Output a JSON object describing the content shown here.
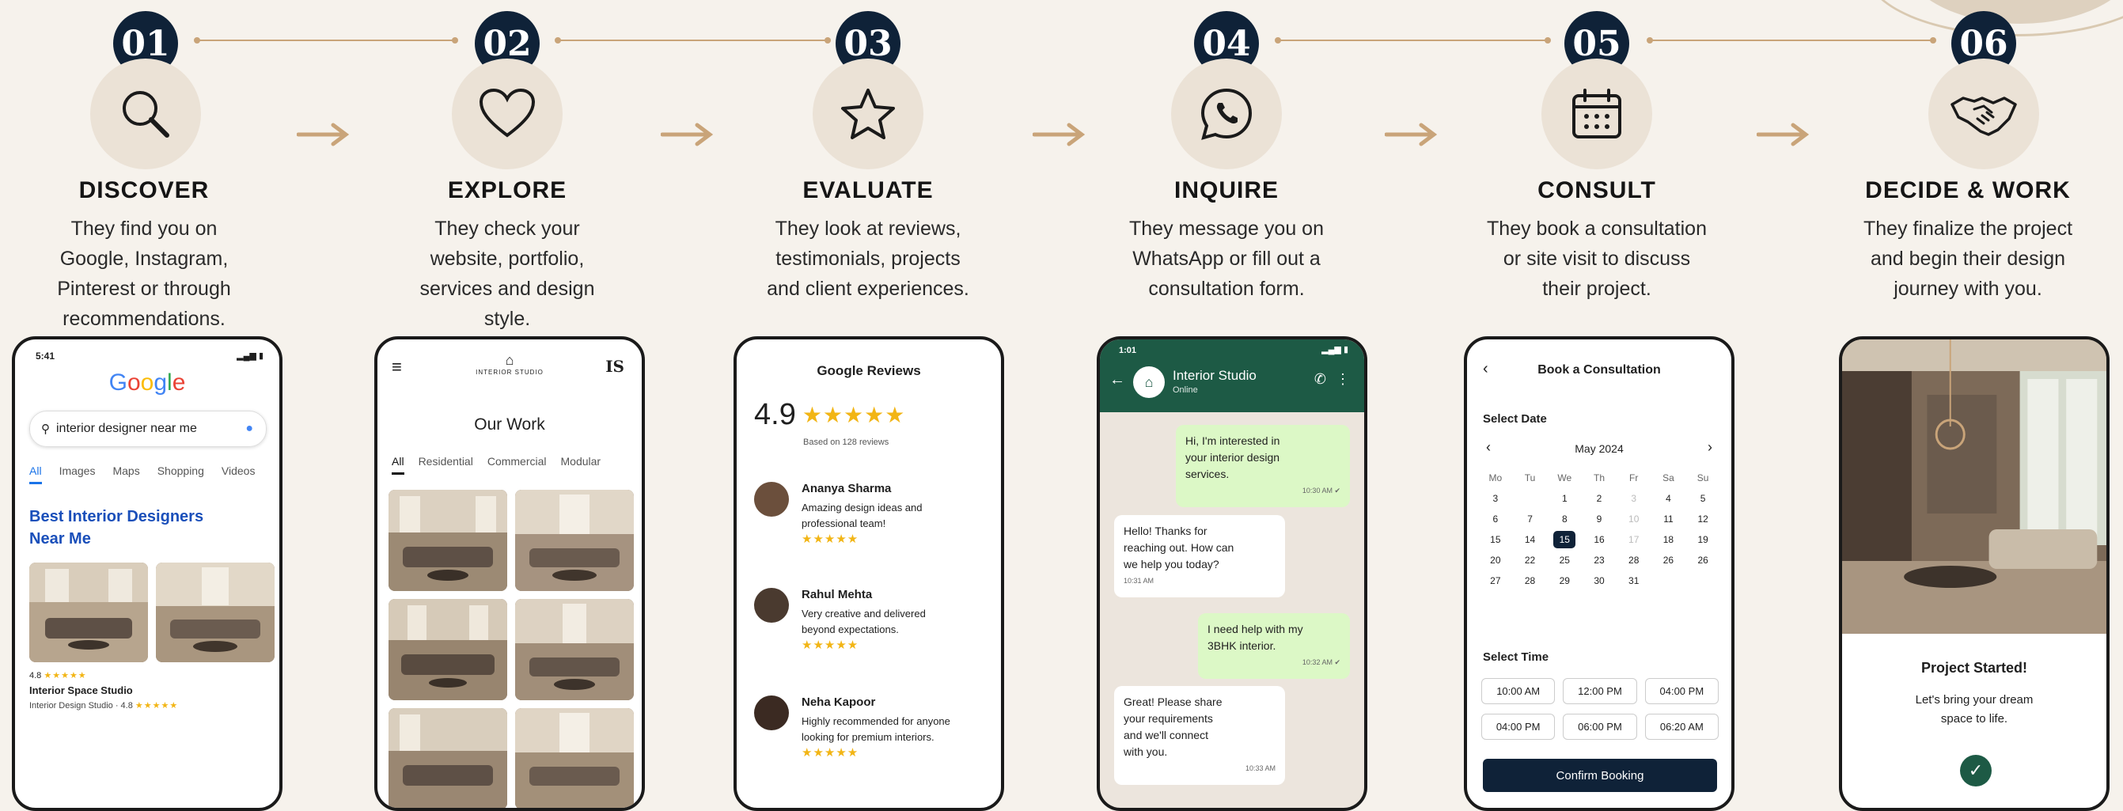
{
  "steps": [
    {
      "num": "01",
      "title": "DISCOVER",
      "desc": [
        "They find you on",
        "Google, Instagram,",
        "Pinterest or through",
        "recommendations."
      ],
      "icon": "magnifier-icon"
    },
    {
      "num": "02",
      "title": "EXPLORE",
      "desc": [
        "They check your",
        "website, portfolio,",
        "services and design",
        "style."
      ],
      "icon": "heart-icon"
    },
    {
      "num": "03",
      "title": "EVALUATE",
      "desc": [
        "They look at reviews,",
        "testimonials, projects",
        "and client experiences."
      ],
      "icon": "star-icon"
    },
    {
      "num": "04",
      "title": "INQUIRE",
      "desc": [
        "They message you on",
        "WhatsApp or fill out a",
        "consultation form."
      ],
      "icon": "whatsapp-icon"
    },
    {
      "num": "05",
      "title": "CONSULT",
      "desc": [
        "They book a consultation",
        "or site visit to discuss",
        "their project."
      ],
      "icon": "calendar-icon"
    },
    {
      "num": "06",
      "title": "DECIDE & WORK",
      "desc": [
        "They finalize the project",
        "and begin their design",
        "journey with you."
      ],
      "icon": "handshake-icon"
    }
  ],
  "google": {
    "time": "5:41",
    "logo": "Google",
    "query": "interior designer near me",
    "tabs": [
      "All",
      "Images",
      "Maps",
      "Shopping",
      "Videos"
    ],
    "heading1": "Best Interior Designers",
    "heading2": "Near Me",
    "rating": "4.8",
    "rating_stars": "★★★★★",
    "studio": "Interior Space Studio",
    "studio_sub": "Interior Design Studio · 4.8",
    "studio_sub_stars": "★★★★★"
  },
  "portfolio": {
    "brand": "INTERIOR STUDIO",
    "initials": "IS",
    "title": "Our Work",
    "tabs": [
      "All",
      "Residential",
      "Commercial",
      "Modular"
    ]
  },
  "reviews": {
    "title": "Google Reviews",
    "score": "4.9",
    "stars": "★★★★★",
    "based": "Based on 128 reviews",
    "items": [
      {
        "name": "Ananya Sharma",
        "text": [
          "Amazing design ideas and",
          "professional team!"
        ],
        "stars": "★★★★★"
      },
      {
        "name": "Rahul Mehta",
        "text": [
          "Very creative and delivered",
          "beyond expectations."
        ],
        "stars": "★★★★★"
      },
      {
        "name": "Neha Kapoor",
        "text": [
          "Highly recommended for anyone",
          "looking for premium interiors."
        ],
        "stars": "★★★★★"
      }
    ]
  },
  "chat": {
    "time": "1:01",
    "name": "Interior Studio",
    "status": "Online",
    "messages": [
      {
        "from": "me",
        "lines": [
          "Hi, I'm interested in",
          "your interior design",
          "services."
        ],
        "time": "10:30 AM ✔"
      },
      {
        "from": "them",
        "lines": [
          "Hello! Thanks for",
          "reaching out. How can",
          "we help you today?"
        ],
        "time": "10:31 AM"
      },
      {
        "from": "me",
        "lines": [
          "I need help with my",
          "3BHK interior."
        ],
        "time": "10:32 AM ✔"
      },
      {
        "from": "them",
        "lines": [
          "Great! Please share",
          "your requirements",
          "and we'll connect",
          "with you."
        ],
        "time": "10:33 AM"
      }
    ]
  },
  "booking": {
    "title": "Book a Consultation",
    "select_date": "Select Date",
    "month": "May 2024",
    "weekdays": [
      "Mo",
      "Tu",
      "We",
      "Th",
      "Fr",
      "Sa",
      "Su"
    ],
    "weeks": [
      [
        "3",
        "",
        "1",
        "2",
        "3",
        "4",
        "5"
      ],
      [
        "6",
        "7",
        "8",
        "9",
        "10",
        "11",
        "12"
      ],
      [
        "15",
        "14",
        "15",
        "16",
        "17",
        "18",
        "19"
      ],
      [
        "20",
        "22",
        "25",
        "23",
        "28",
        "26",
        "26"
      ],
      [
        "27",
        "28",
        "29",
        "30",
        "31",
        "",
        ""
      ]
    ],
    "selected_day": "15",
    "select_time": "Select Time",
    "times": [
      "10:00 AM",
      "12:00 PM",
      "04:00 PM",
      "04:00 PM",
      "06:00 PM",
      "06:20 AM"
    ],
    "confirm": "Confirm Booking"
  },
  "final": {
    "title": "Project Started!",
    "line1": "Let's bring your dream",
    "line2": "space to life."
  },
  "colors": {
    "navy": "#0f2238",
    "gold": "#c9a479",
    "whatsapp": "#1d5a45",
    "beige": "#ebe2d6",
    "star": "#f2b515"
  }
}
